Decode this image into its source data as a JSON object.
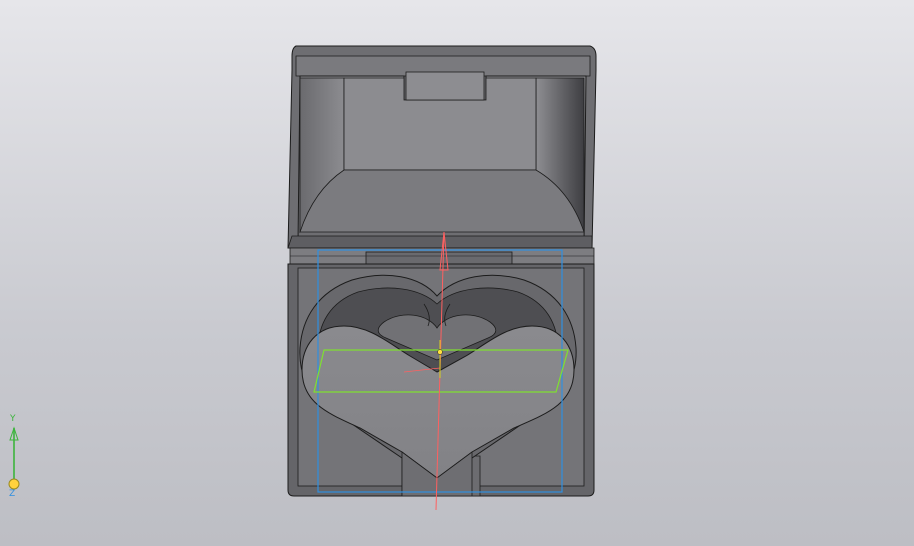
{
  "viewport": {
    "model": "heart-box",
    "colors": {
      "background_top": "#e6e6ea",
      "background_bottom": "#bdbec4",
      "model_dark": "#5f5f62",
      "model_mid": "#7e7e82",
      "model_light": "#9a9a9e",
      "edge": "#1c1c1c",
      "sketch_blue": "#2f8fe0",
      "sketch_green": "#7fe030",
      "axis_red": "#ff6060"
    }
  },
  "triad": {
    "y_label": "Y",
    "z_label": "Z",
    "y_color": "#3cb43c",
    "origin_color": "#ffd23c"
  }
}
